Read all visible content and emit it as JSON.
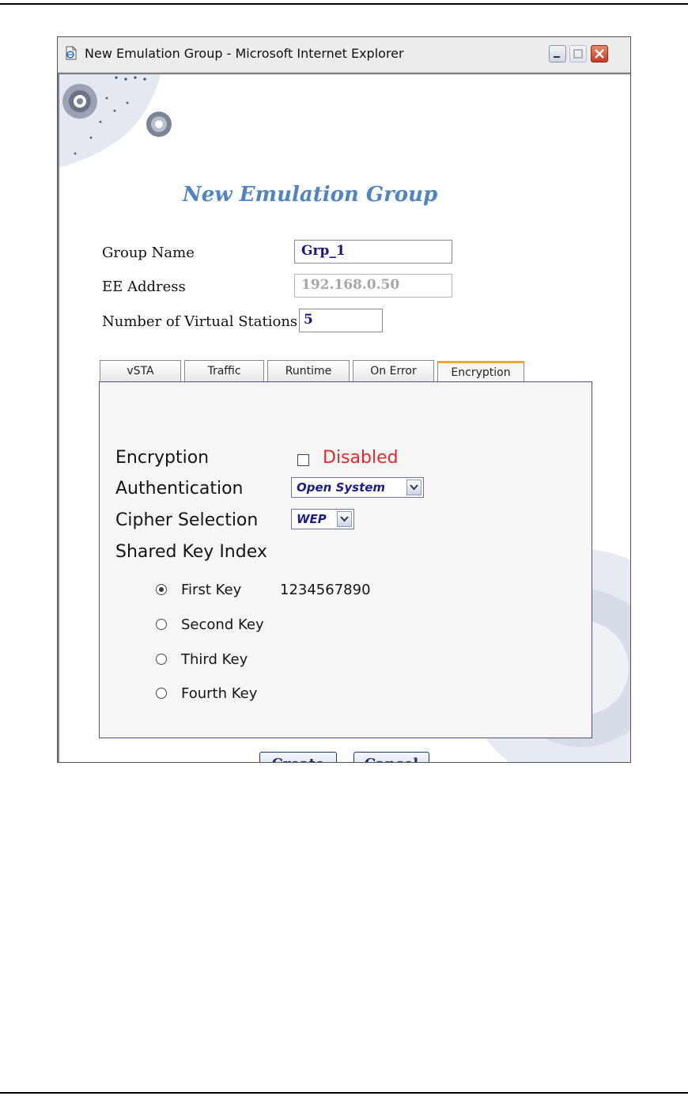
{
  "window": {
    "title": "New Emulation Group - Microsoft Internet Explorer"
  },
  "page": {
    "title": "New Emulation Group"
  },
  "form": {
    "group_name_label": "Group Name",
    "group_name_value": "Grp_1",
    "ee_address_label": "EE Address",
    "ee_address_value": "192.168.0.50",
    "stations_label": "Number of Virtual Stations",
    "stations_value": "5"
  },
  "tabs": [
    {
      "label": "vSTA"
    },
    {
      "label": "Traffic"
    },
    {
      "label": "Runtime"
    },
    {
      "label": "On Error"
    },
    {
      "label": "Encryption",
      "active": true
    }
  ],
  "encryption": {
    "encryption_label": "Encryption",
    "encryption_checked": false,
    "encryption_state_text": "Disabled",
    "authentication_label": "Authentication",
    "authentication_value": "Open System",
    "cipher_label": "Cipher Selection",
    "cipher_value": "WEP",
    "shared_key_label": "Shared Key Index",
    "keys": [
      {
        "label": "First Key",
        "value": "1234567890",
        "selected": true
      },
      {
        "label": "Second Key",
        "value": "",
        "selected": false
      },
      {
        "label": "Third Key",
        "value": "",
        "selected": false
      },
      {
        "label": "Fourth Key",
        "value": "",
        "selected": false
      }
    ]
  },
  "buttons": {
    "create": "Create",
    "cancel": "Cancel"
  },
  "colors": {
    "title_accent": "#4f84c2",
    "disabled_text": "#e8282d",
    "active_tab_border": "#f0a735",
    "input_text": "#1a1a7c"
  },
  "icons": {
    "title_icon": "ie-page-icon",
    "decoration": "gear-icon"
  }
}
